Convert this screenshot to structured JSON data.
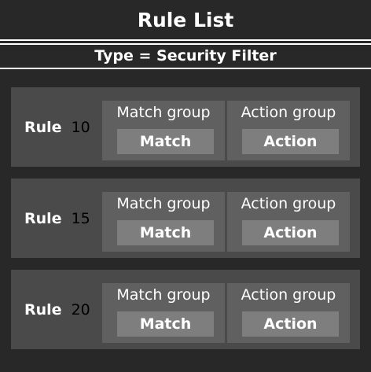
{
  "header": {
    "title": "Rule List",
    "subtitle": "Type = Security Filter"
  },
  "rules": [
    {
      "label": "Rule",
      "number": "10",
      "match_group_title": "Match group",
      "match_button": "Match",
      "action_group_title": "Action group",
      "action_button": "Action"
    },
    {
      "label": "Rule",
      "number": "15",
      "match_group_title": "Match group",
      "match_button": "Match",
      "action_group_title": "Action group",
      "action_button": "Action"
    },
    {
      "label": "Rule",
      "number": "20",
      "match_group_title": "Match group",
      "match_button": "Match",
      "action_group_title": "Action group",
      "action_button": "Action"
    }
  ],
  "colors": {
    "background": "#282828",
    "rule_panel": "#4a4a4a",
    "group_box": "#606060",
    "button": "#7e7e7e",
    "text": "#ffffff"
  }
}
